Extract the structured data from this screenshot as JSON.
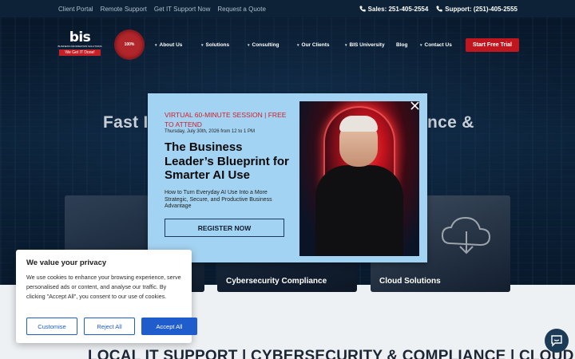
{
  "topbar": {
    "links": [
      "Client Portal",
      "Remote Support",
      "Get IT Support Now",
      "Request a Quote"
    ],
    "sales": "Sales: 251-405-2554",
    "support": "Support: (251)-405-2555"
  },
  "nav": {
    "logo_text": "bis",
    "logo_sub": "BUSINESS INFORMATION SOLUTIONS",
    "logo_tag": "We Get IT Done!",
    "seal_text": "100%",
    "items": [
      "About Us",
      "Solutions",
      "Consulting",
      "Our Clients",
      "BIS University",
      "Blog",
      "Contact Us"
    ],
    "cta": "Start Free Trial"
  },
  "hero": {
    "title_left": "Fast I",
    "title_right": "nce &"
  },
  "cards": [
    {
      "label": ""
    },
    {
      "label": "Cybersecurity Compliance"
    },
    {
      "label": "Cloud Solutions"
    }
  ],
  "bottom_headline": "LOCAL IT SUPPORT | CYBERSECURITY & COMPLIANCE | CLOUD",
  "modal": {
    "session": "VIRTUAL 60-MINUTE SESSION | FREE TO ATTEND",
    "date": "Thursday, July 30th, 2026 from 12 to 1 PM",
    "title": "The Business Leader’s Blueprint for Smarter AI Use",
    "description": "How to Turn Everyday AI Use Into a More Strategic, Secure, and Productive Business Advantage",
    "register": "REGISTER NOW"
  },
  "cookie": {
    "title": "We value your privacy",
    "body": "We use cookies to enhance your browsing experience, serve personalised ads or content, and analyse our traffic. By clicking \"Accept All\", you consent to our use of cookies.",
    "customise": "Customise",
    "reject": "Reject All",
    "accept": "Accept All"
  },
  "colors": {
    "accent_red": "#c0161d",
    "accept_blue": "#1f5ccc",
    "modal_bg": "#a3d3f2",
    "topbar_bg": "#0d2236"
  },
  "icons": [
    "phone-icon",
    "close-icon",
    "chat-icon",
    "chevron-down-icon"
  ]
}
